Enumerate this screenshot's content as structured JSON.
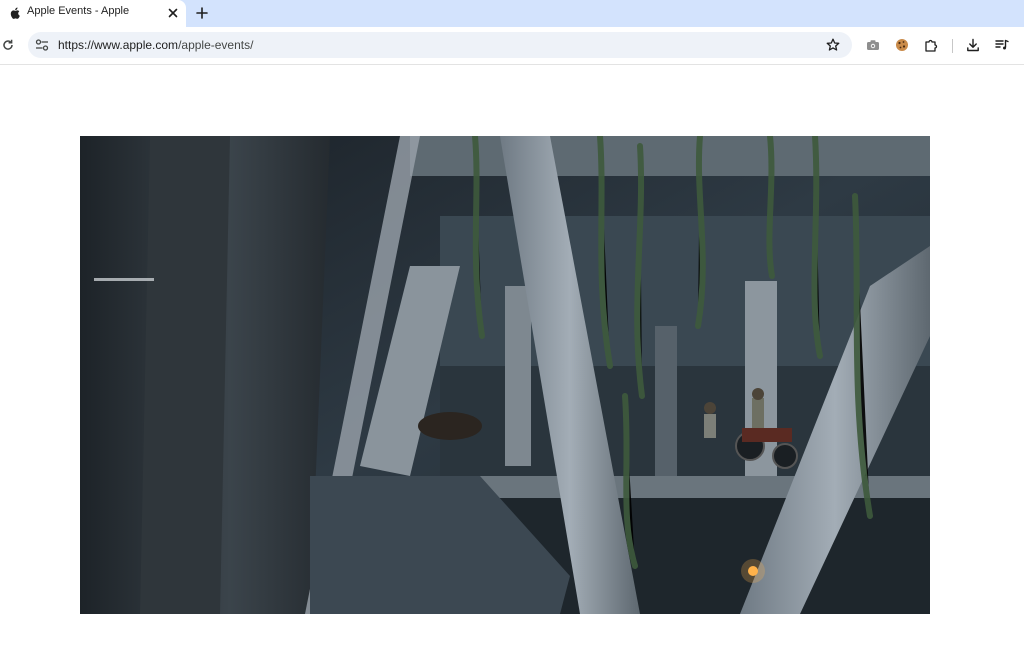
{
  "browser": {
    "tab": {
      "title": "Apple Events - Apple",
      "favicon": "apple-logo-icon"
    },
    "address_bar": {
      "url_scheme_host": "https://www.apple.com",
      "url_path": "/apple-events/"
    }
  },
  "icons": {
    "tab_close": "close-icon",
    "new_tab": "plus-icon",
    "reload": "reload-icon",
    "site_info": "tune-icon",
    "bookmark": "star-icon",
    "screenshot": "camera-icon",
    "cookie_extension": "cookie-icon",
    "extensions": "puzzle-icon",
    "downloads": "download-icon",
    "media_control": "queue-music-icon"
  },
  "main": {
    "video": {
      "scene": "video-frame"
    }
  },
  "colors": {
    "tabstrip": "#d3e3fd",
    "omnibox": "#eef2f8"
  }
}
